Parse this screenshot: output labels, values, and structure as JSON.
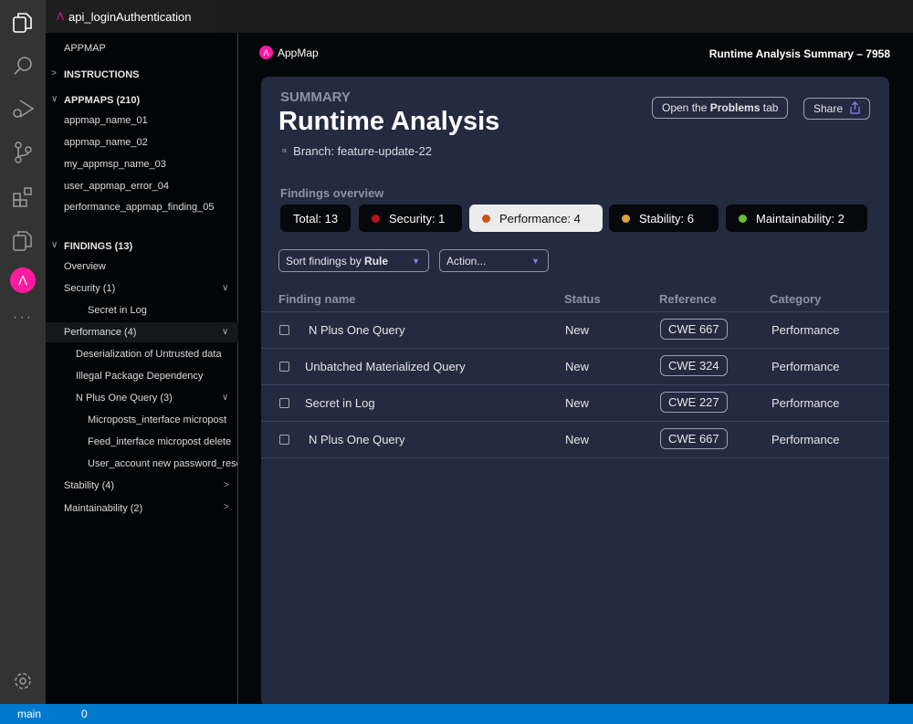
{
  "tab": {
    "title": "api_loginAuthentication",
    "icon": "appmap-logo-icon"
  },
  "activity_bar": [
    "explorer-icon",
    "search-icon",
    "run-debug-icon",
    "source-control-icon",
    "extensions-icon",
    "copy-icon",
    "appmap-icon",
    "more-icon",
    "settings-gear-icon"
  ],
  "sidebar": {
    "header": "APPMAP",
    "instructions": "INSTRUCTIONS",
    "appmaps_header": "APPMAPS (210)",
    "appmaps": [
      "appmap_name_01",
      "appmap_name_02",
      "my_appmsp_name_03",
      "user_appmap_error_04",
      "performance_appmap_finding_05"
    ],
    "findings_header": "FINDINGS (13)",
    "overview": "Overview",
    "security": "Security (1)",
    "secret_in_log": "Secret in Log",
    "performance": "Performance (4)",
    "perf_items": [
      "Deserialization of Untrusted data",
      "Illegal Package Dependency",
      "N Plus One Query (3)"
    ],
    "nplus_items": [
      "Microposts_interface micropost",
      "Feed_interface micropost delete",
      "User_account new password_reset"
    ],
    "stability": "Stability (4)",
    "maintainability": "Maintainability (2)"
  },
  "header": {
    "brand": "AppMap",
    "title": "Runtime Analysis Summary – 7958"
  },
  "summary": {
    "eyebrow": "SUMMARY",
    "title": "Runtime Analysis",
    "branch": "Branch: feature-update-22",
    "open_problems_pre": "Open the ",
    "open_problems_bold": "Problems",
    "open_problems_post": " tab",
    "share": "Share",
    "overview_label": "Findings overview",
    "pills": [
      {
        "label": "Total: 13"
      },
      {
        "label": "Security: 1",
        "color": "#b3141b"
      },
      {
        "label": "Performance: 4",
        "color": "#c9541a",
        "active": true
      },
      {
        "label": "Stability: 6",
        "color": "#e0a040"
      },
      {
        "label": "Maintainability: 2",
        "color": "#6cbd3a"
      }
    ],
    "sort_pre": "Sort findings by ",
    "sort_bold": "Rule",
    "action": "Action..."
  },
  "table": {
    "headers": [
      "Finding name",
      "Status",
      "Reference",
      "Category"
    ],
    "rows": [
      {
        "name": "N Plus One Query",
        "status": "New",
        "reference": "CWE 667",
        "category": "Performance"
      },
      {
        "name": "Unbatched Materialized Query",
        "status": "New",
        "reference": "CWE 324",
        "category": "Performance"
      },
      {
        "name": "Secret in Log",
        "status": "New",
        "reference": "CWE 227",
        "category": "Performance"
      },
      {
        "name": "N Plus One Query",
        "status": "New",
        "reference": "CWE 667",
        "category": "Performance"
      }
    ]
  },
  "status_bar": {
    "branch": "main",
    "problems": "0"
  }
}
